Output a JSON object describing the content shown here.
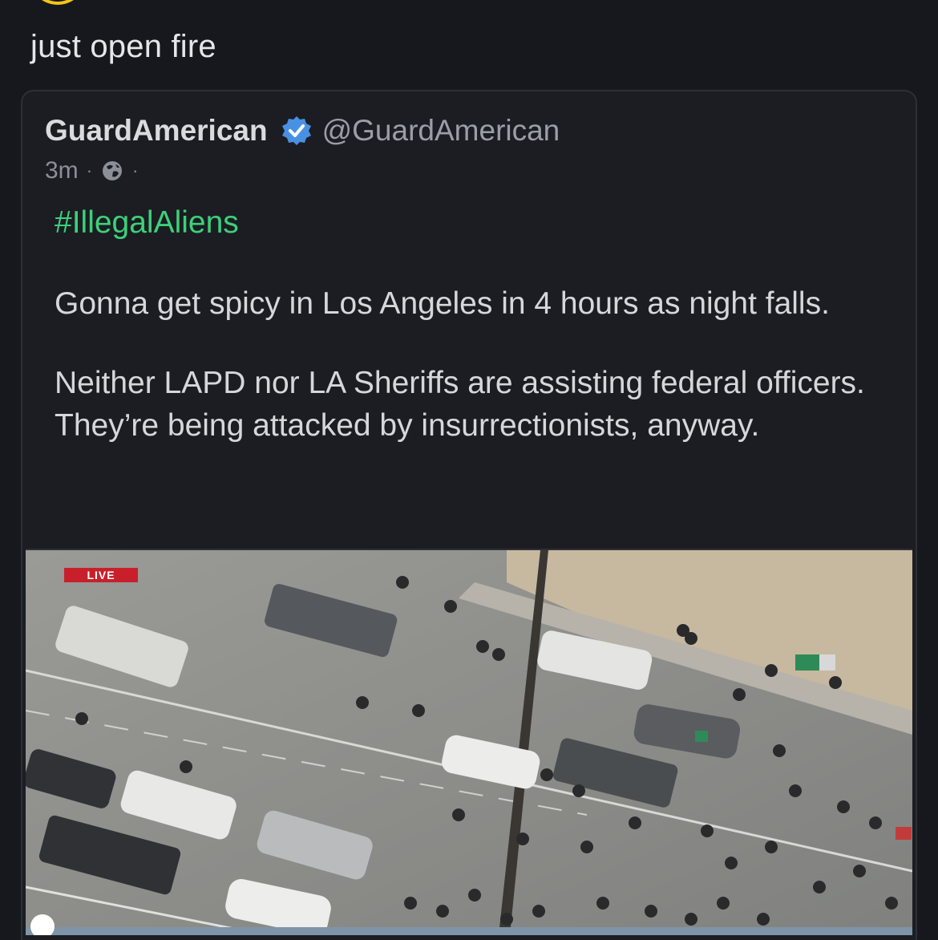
{
  "reply": {
    "text": "just open fire"
  },
  "quote": {
    "display_name": "GuardAmerican",
    "handle": "@GuardAmerican",
    "time": "3m",
    "separator": "·",
    "hashtag": "#IllegalAliens",
    "paragraphs": [
      "Gonna get spicy in Los Angeles in 4 hours as night falls.",
      "Neither LAPD nor LA Sheriffs are assisting federal officers. They’re being attacked by insurrectionists, anyway."
    ],
    "media": {
      "badge": "LIVE",
      "progress": 0.0
    }
  },
  "colors": {
    "background": "#16181d",
    "hashtag": "#3dd07a",
    "verified": "#4a90e2",
    "live_badge": "#c8202a",
    "avatar_ring": "#f5c518"
  }
}
